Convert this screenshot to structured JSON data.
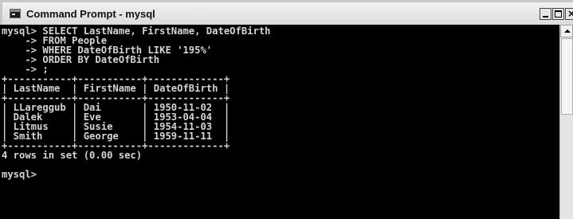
{
  "window": {
    "title": "Command Prompt - mysql",
    "icon": "console-icon",
    "buttons": {
      "minimize": "minimize",
      "maximize": "maximize",
      "close": "close"
    }
  },
  "console": {
    "query_lines": [
      "mysql> SELECT LastName, FirstName, DateOfBirth",
      "    -> FROM People",
      "    -> WHERE DateOfBirth LIKE '195%'",
      "    -> ORDER BY DateOfBirth",
      "    -> ;"
    ],
    "table": {
      "border": "+-----------+-----------+-------------+",
      "header": "| LastName  | FirstName | DateOfBirth |",
      "rows": [
        "| LLareggub | Dai       | 1950-11-02  |",
        "| Dalek     | Eve       | 1953-04-04  |",
        "| Litmus    | Susie     | 1954-11-03  |",
        "| Smith     | George    | 1959-11-11  |"
      ]
    },
    "summary": "4 rows in set (0.00 sec)",
    "prompt": "mysql>"
  },
  "colors": {
    "console_bg": "#000000",
    "console_text": "#d4d4d4",
    "titlebar": "#e6e6e6"
  }
}
